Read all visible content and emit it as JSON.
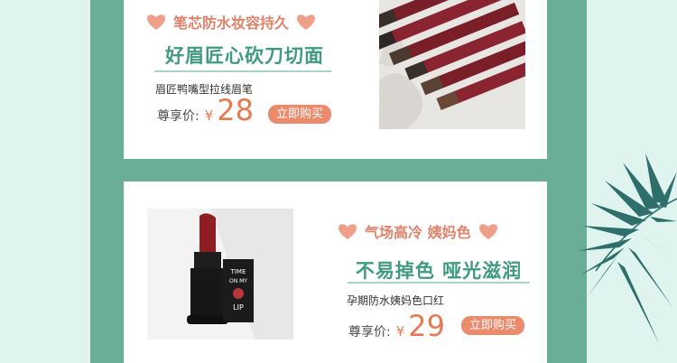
{
  "products": [
    {
      "slogan": "笔芯防水妆容持久",
      "headline": "好眉匠心砍刀切面",
      "name": "眉匠鸭嘴型拉线眉笔",
      "price_label": "尊享价:",
      "currency": "¥",
      "price": "28",
      "buy_label": "立即购买",
      "image_icon": "eyebrow-pencils-photo"
    },
    {
      "slogan": "气场高冷 姨妈色",
      "headline": "不易掉色 哑光滋润",
      "name": "孕期防水姨妈色口红",
      "price_label": "尊享价:",
      "currency": "¥",
      "price": "29",
      "buy_label": "立即购买",
      "image_icon": "lipstick-photo",
      "box_text": [
        "TIME",
        "ON MY",
        "LIP"
      ]
    }
  ],
  "colors": {
    "page_bg": "#dff4ef",
    "band": "#6bae98",
    "accent_green": "#3f9b7f",
    "accent_orange": "#e77a4f",
    "button": "#ec8a6c"
  },
  "decor_icon": "palm-leaf-icon"
}
